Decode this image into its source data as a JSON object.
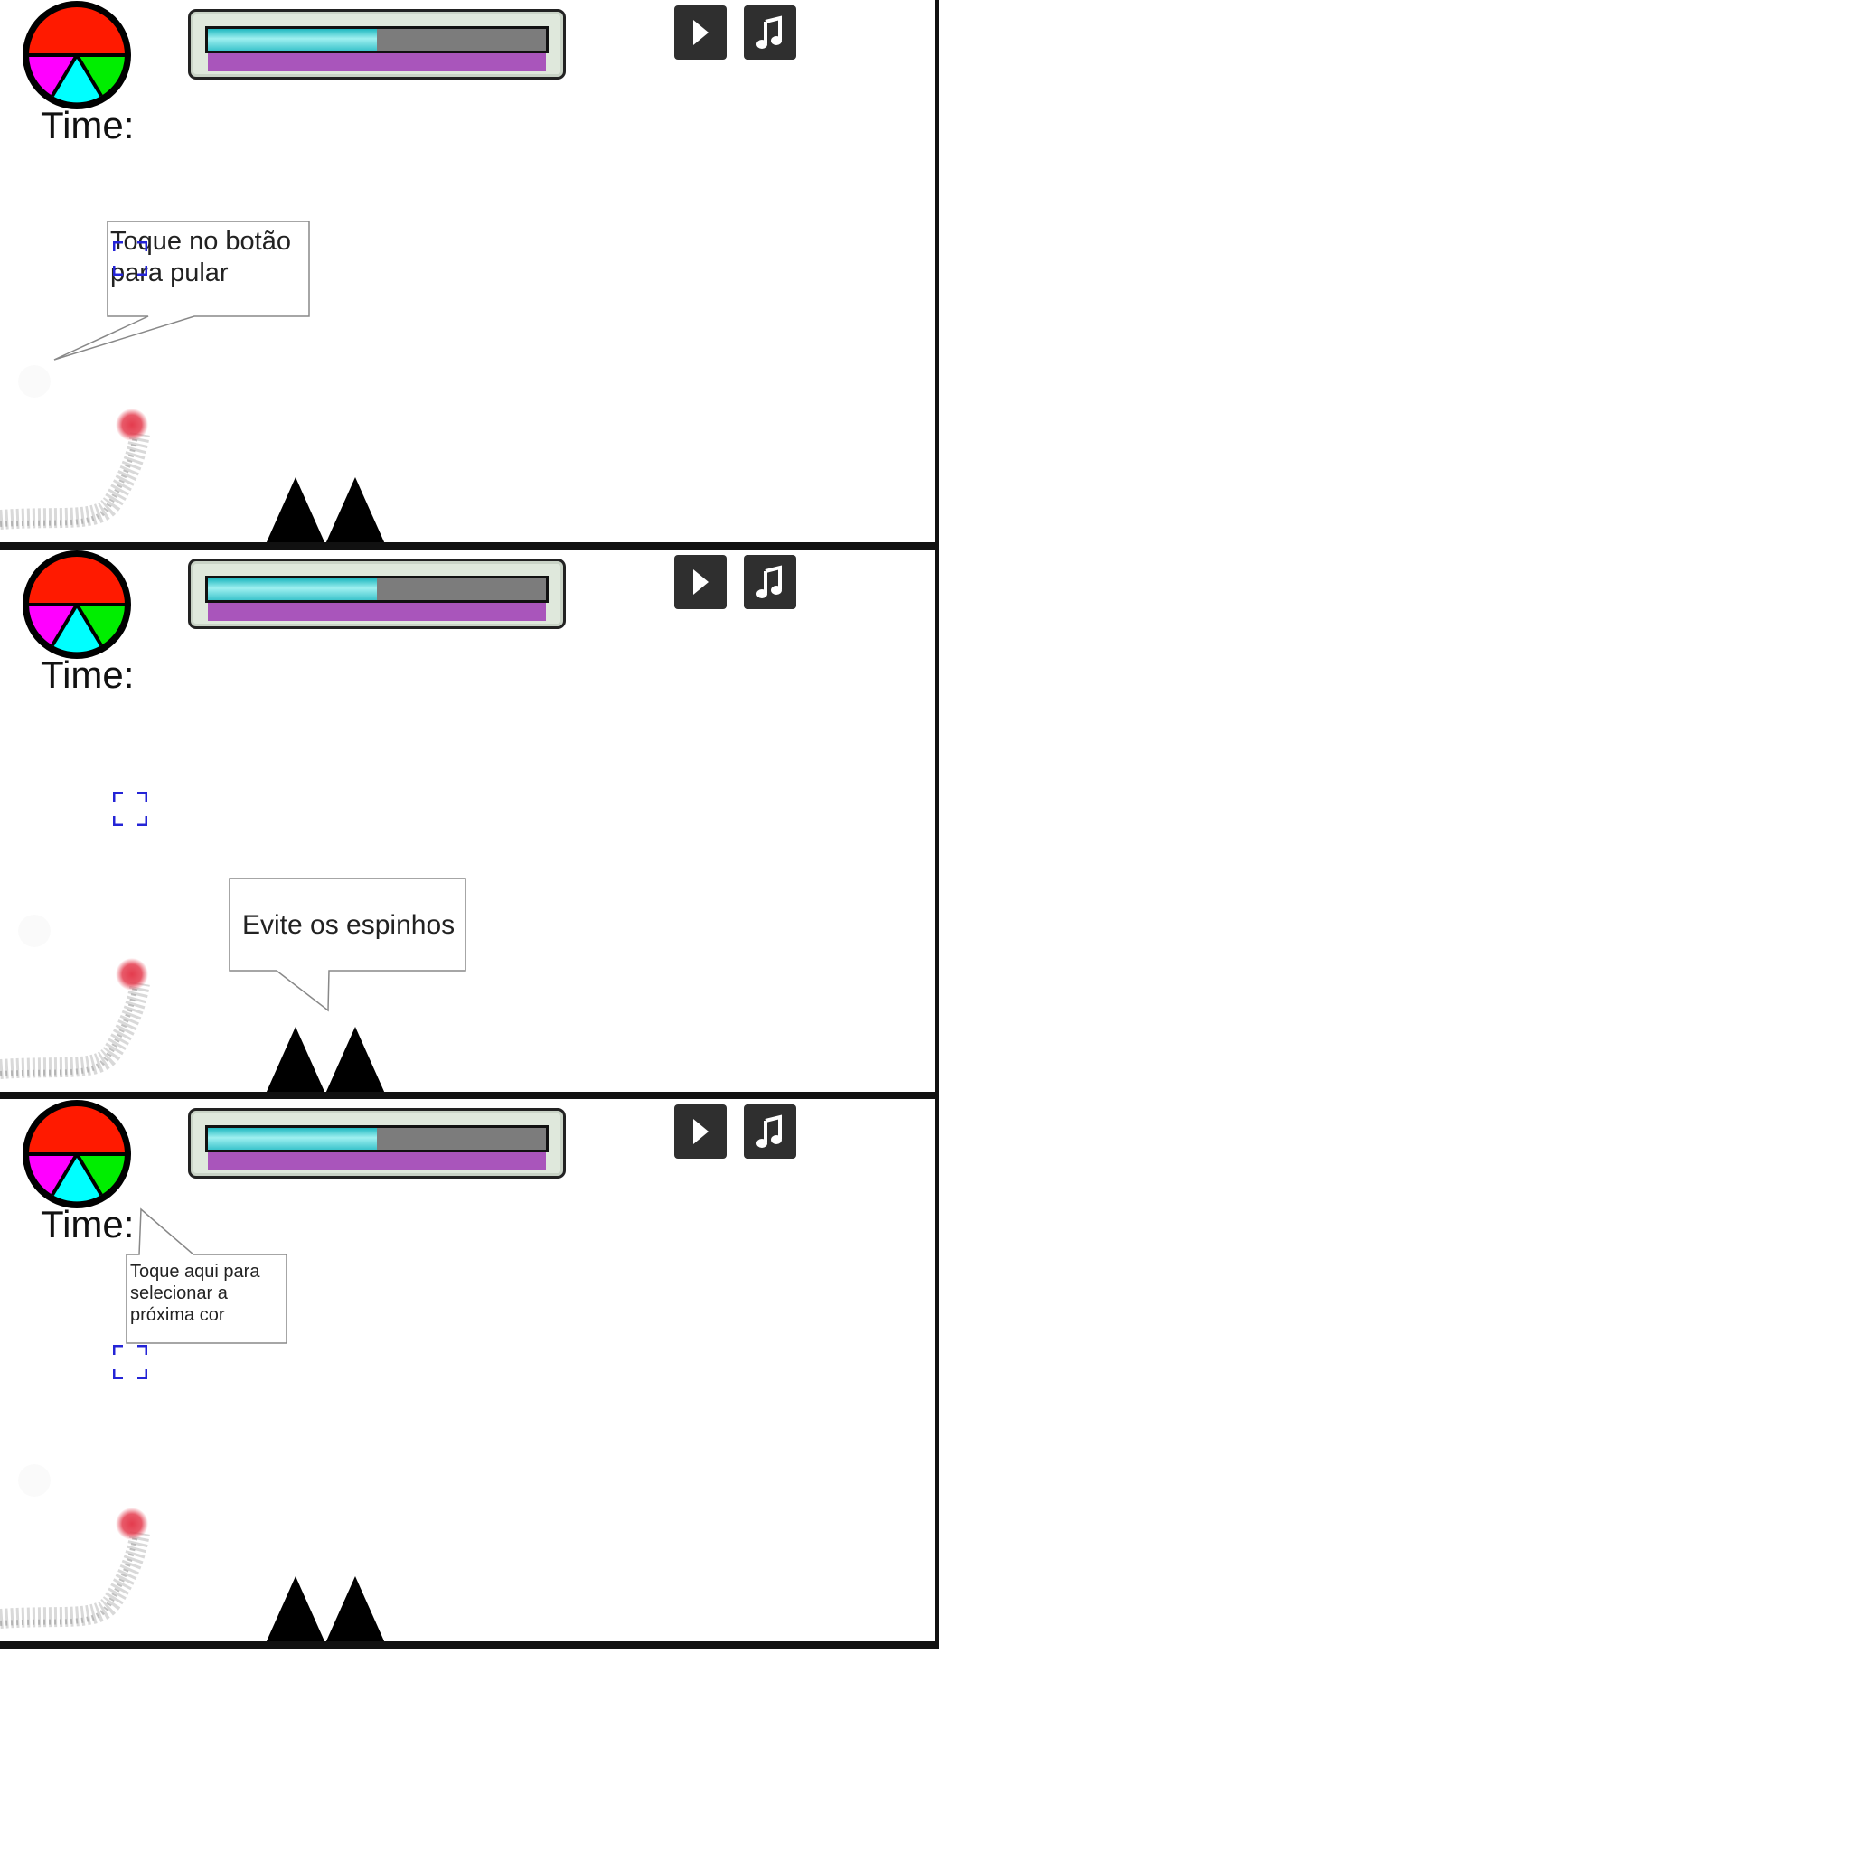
{
  "hud": {
    "time_label": "Time:",
    "play_icon": "play-icon",
    "music_icon": "music-note-icon",
    "color_wheel_icon": "color-wheel-icon",
    "energy_level": 0.5,
    "secondary_level": 1.0
  },
  "colors": {
    "wheel_top": "#ff1a00",
    "wheel_left": "#ff00ff",
    "wheel_middle": "#00ffff",
    "wheel_right": "#00ee00",
    "ball": "#e43c4e",
    "progress_line": "#ff00ff",
    "focus_marker": "#2424d6"
  },
  "panels": [
    {
      "tip": "Toque no botão para pular",
      "tip_lines": [
        "Toque no botão",
        "para pular"
      ]
    },
    {
      "tip": "Evite os espinhos",
      "tip_lines": [
        "Evite os espinhos"
      ]
    },
    {
      "tip": "Toque aqui para selecionar a próxima cor",
      "tip_lines": [
        "Toque aqui para",
        "selecionar a",
        "próxima cor"
      ]
    }
  ]
}
